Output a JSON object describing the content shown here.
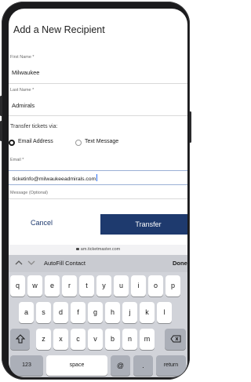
{
  "page": {
    "title": "Add a New Recipient"
  },
  "form": {
    "first_name_label": "First Name *",
    "first_name_value": "Milwaukee",
    "last_name_label": "Last Name *",
    "last_name_value": "Admirals",
    "transfer_via_label": "Transfer tickets via:",
    "option_email": "Email Address",
    "option_text": "Text Message",
    "selected_option": "Email Address",
    "email_label": "Email *",
    "email_value": "ticketinfo@milwaukeeadmirals.com",
    "message_label": "Message (Optional)"
  },
  "actions": {
    "cancel_label": "Cancel",
    "transfer_label": "Transfer"
  },
  "browser": {
    "url": "am.ticketmaster.com",
    "lock_icon": "lock-icon"
  },
  "keyboard": {
    "autofill_label": "AutoFill Contact",
    "done_label": "Done",
    "row1": [
      "q",
      "w",
      "e",
      "r",
      "t",
      "y",
      "u",
      "i",
      "o",
      "p"
    ],
    "row2": [
      "a",
      "s",
      "d",
      "f",
      "g",
      "h",
      "j",
      "k",
      "l"
    ],
    "row3": [
      "z",
      "x",
      "c",
      "v",
      "b",
      "n",
      "m"
    ],
    "shift_icon": "shift-icon",
    "delete_icon": "delete-icon",
    "numbers_label": "123",
    "space_label": "space",
    "at_label": "@",
    "dot_label": ".",
    "return_label": "return"
  }
}
